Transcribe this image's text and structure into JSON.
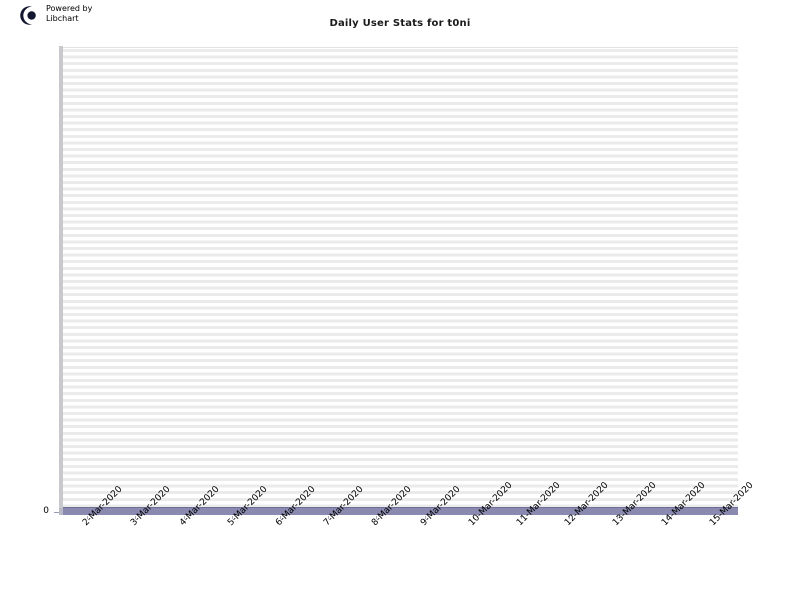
{
  "branding": {
    "logo_icon": "libchart-crescent-logo",
    "line1": "Powered by",
    "line2": "Libchart"
  },
  "chart_data": {
    "type": "bar",
    "title": "Daily User Stats for t0ni",
    "xlabel": "",
    "ylabel": "",
    "grid": true,
    "legend": "none",
    "ylim": [
      0,
      1
    ],
    "y_ticks": [
      "0"
    ],
    "bar_color": "#8a8ab0",
    "plot_background": "#ebebeb",
    "categories": [
      "2-Mar-2020",
      "3-Mar-2020",
      "4-Mar-2020",
      "5-Mar-2020",
      "6-Mar-2020",
      "7-Mar-2020",
      "8-Mar-2020",
      "9-Mar-2020",
      "10-Mar-2020",
      "11-Mar-2020",
      "12-Mar-2020",
      "13-Mar-2020",
      "14-Mar-2020",
      "15-Mar-2020"
    ],
    "values": [
      0,
      0,
      0,
      0,
      0,
      0,
      0,
      0,
      0,
      0,
      0,
      0,
      0,
      0
    ]
  }
}
